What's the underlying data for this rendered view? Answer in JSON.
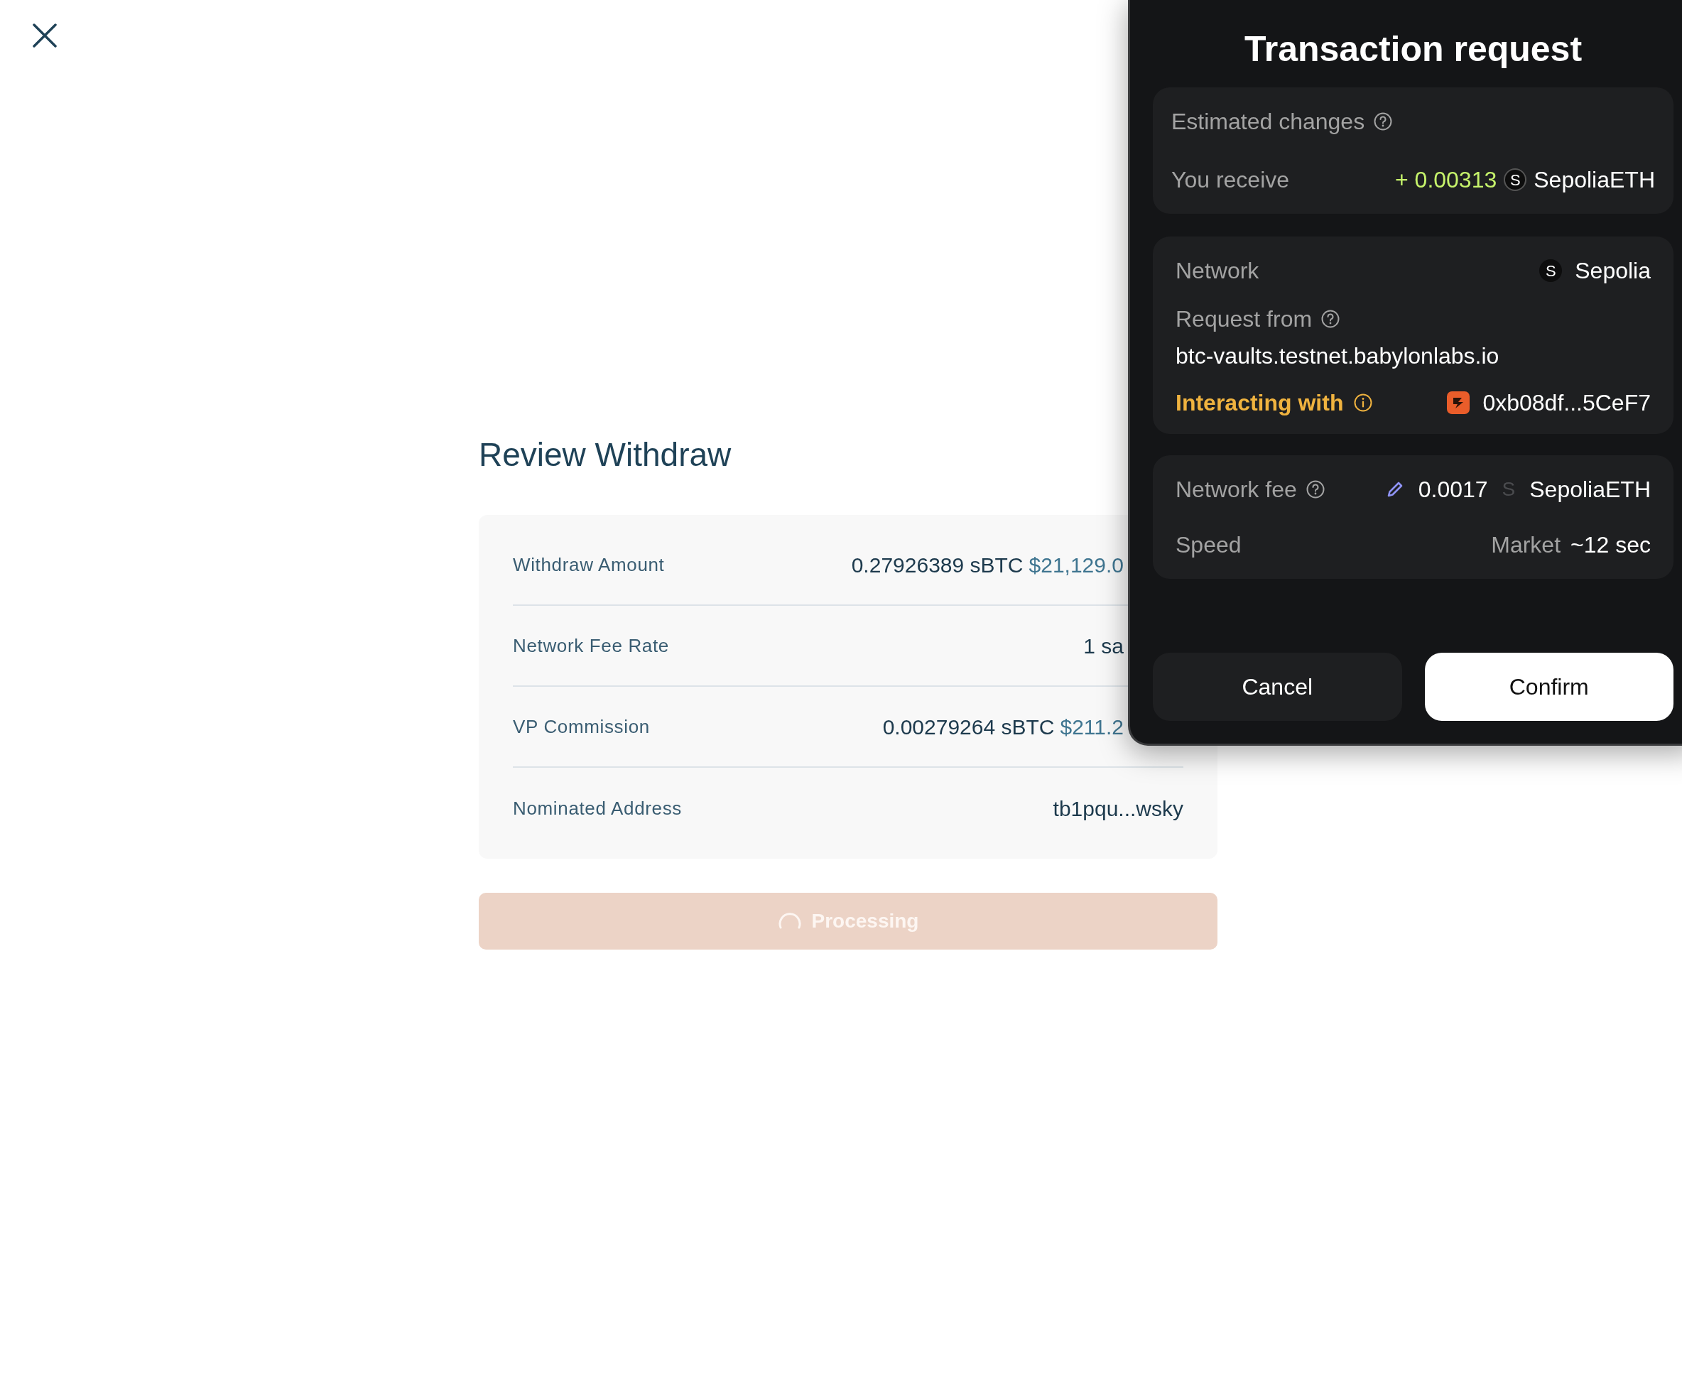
{
  "page": {
    "title": "Review Withdraw",
    "rows": [
      {
        "label": "Withdraw Amount",
        "amount": "0.27926389 sBTC",
        "fiat": "$21,129.0"
      },
      {
        "label": "Network Fee Rate",
        "amount": "1 sa"
      },
      {
        "label": "VP Commission",
        "amount": "0.00279264 sBTC",
        "fiat": "$211.2"
      },
      {
        "label": "Nominated Address",
        "amount": "tb1pqu...wsky"
      }
    ],
    "submit": {
      "label": "Processing",
      "loading": true,
      "disabled": true
    }
  },
  "wallet_popup": {
    "title": "Transaction request",
    "estimated_changes": {
      "heading": "Estimated changes",
      "label": "You receive",
      "amount": "+ 0.00313",
      "token_letter": "S",
      "token": "SepoliaETH"
    },
    "details": {
      "network_label": "Network",
      "network_letter": "S",
      "network": "Sepolia",
      "request_label": "Request from",
      "request_origin": "btc-vaults.testnet.babylonlabs.io",
      "interacting_label": "Interacting with",
      "contract": "0xb08df...5CeF7"
    },
    "fees": {
      "fee_label": "Network fee",
      "fee": "0.0017",
      "fee_letter": "S",
      "fee_token": "SepoliaETH",
      "speed_label": "Speed",
      "speed_mode": "Market",
      "speed_time": "~12 sec"
    },
    "buttons": [
      {
        "label": "Cancel",
        "kind": "secondary"
      },
      {
        "label": "Confirm",
        "kind": "primary"
      }
    ]
  }
}
